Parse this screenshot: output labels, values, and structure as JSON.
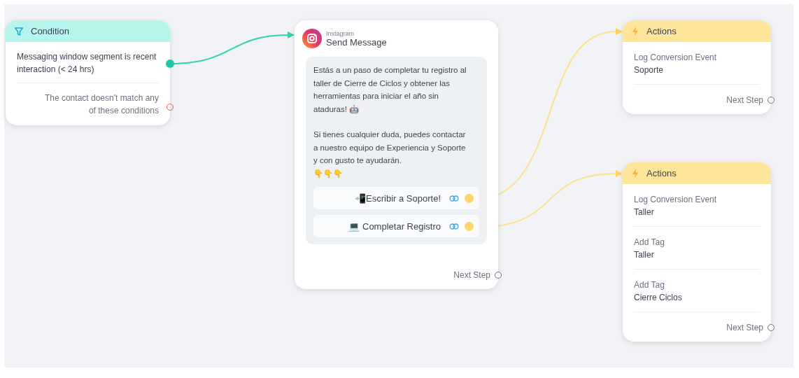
{
  "condition": {
    "title": "Condition",
    "rows": [
      {
        "kind": "match",
        "text": "Messaging window segment is recent interaction (< 24 hrs)"
      },
      {
        "kind": "else",
        "text": "The contact doesn't match any of these conditions"
      }
    ]
  },
  "message": {
    "channel": "Instagram",
    "title": "Send Message",
    "paragraphs": [
      "Estás a un paso de completar tu registro al taller de Cierre de Ciclos y obtener las herramientas para iniciar el año sin ataduras! 🤖",
      "Si tienes cualquier duda, puedes contactar a nuestro equipo de Experiencia y Soporte y con gusto te ayudarán.\n👇👇👇"
    ],
    "buttons": [
      {
        "label": "📲Escribir a Soporte!"
      },
      {
        "label": "💻 Completar Registro"
      }
    ],
    "next_step": "Next Step"
  },
  "actions": [
    {
      "title": "Actions",
      "items": [
        {
          "label": "Log Conversion Event",
          "value": "Soporte"
        }
      ],
      "next_step": "Next Step"
    },
    {
      "title": "Actions",
      "items": [
        {
          "label": "Log Conversion Event",
          "value": "Taller"
        },
        {
          "label": "Add Tag",
          "value": "Taller"
        },
        {
          "label": "Add Tag",
          "value": "Cierre Ciclos"
        }
      ],
      "next_step": "Next Step"
    }
  ]
}
